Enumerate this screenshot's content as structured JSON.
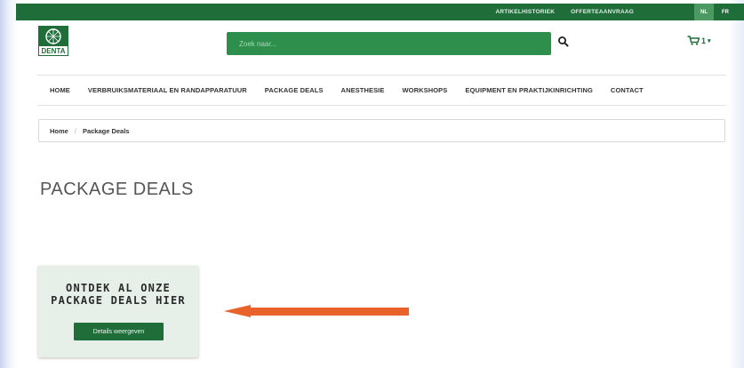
{
  "topbar": {
    "links": [
      "ARTIKELHISTORIEK",
      "OFFERTEAANVRAAG"
    ],
    "lang_nl": "NL",
    "lang_fr": "FR"
  },
  "header": {
    "logo_text": "DENTA",
    "search_placeholder": "Zoek naar...",
    "cart_count": "1"
  },
  "nav": {
    "items": [
      "HOME",
      "VERBRUIKSMATERIAAL EN RANDAPPARATUUR",
      "PACKAGE DEALS",
      "ANESTHESIE",
      "WORKSHOPS",
      "EQUIPMENT EN PRAKTIJKINRICHTING",
      "CONTACT"
    ]
  },
  "breadcrumb": {
    "home": "Home",
    "separator": "/",
    "current": "Package Deals"
  },
  "page": {
    "title": "PACKAGE DEALS"
  },
  "card": {
    "title_line1": "ONTDEK AL ONZE",
    "title_line2": "PACKAGE DEALS HIER",
    "button_label": "Details weergeven"
  },
  "colors": {
    "brand_green": "#1f6e3a",
    "search_green": "#2e8e4b",
    "arrow_orange": "#e8622a"
  }
}
